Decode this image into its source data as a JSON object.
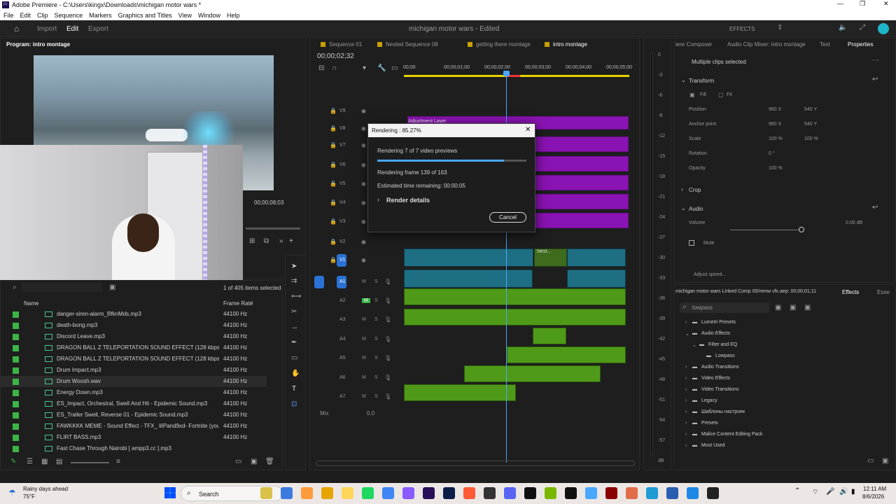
{
  "window": {
    "title": "Adobe Premiere - C:\\Users\\kingx\\Downloads\\michigan motor wars *"
  },
  "menu": [
    "File",
    "Edit",
    "Clip",
    "Sequence",
    "Markers",
    "Graphics and Titles",
    "View",
    "Window",
    "Help"
  ],
  "topbar": {
    "tabs": [
      "Import",
      "Edit",
      "Export"
    ],
    "project": "michigan motor wars - Edited",
    "effects_label": "EFFECTS"
  },
  "program": {
    "label": "Program: intro montage",
    "timecode": "00;00;08;03"
  },
  "project_panel": {
    "count": "1 of 405 items selected",
    "col_name": "Name",
    "col_rate": "Frame Rate",
    "rows": [
      {
        "name": "danger-siren-alarm_BfknMds.mp3",
        "rate": "44100 Hz"
      },
      {
        "name": "death-bong.mp3",
        "rate": "44100 Hz"
      },
      {
        "name": "Discord Leave.mp3",
        "rate": "44100 Hz"
      },
      {
        "name": "DRAGON BALL Z TELEPORTATION SOUND EFFECT (128  kbps).mp3",
        "rate": "44100 Hz"
      },
      {
        "name": "DRAGON BALL Z TELEPORTATION SOUND EFFECT (128  kbps)_001.m",
        "rate": "44100 Hz"
      },
      {
        "name": "Drum Impact.mp3",
        "rate": "44100 Hz"
      },
      {
        "name": "Drum Woosh.wav",
        "rate": "44100 Hz"
      },
      {
        "name": "Energy Down.mp3",
        "rate": "44100 Hz"
      },
      {
        "name": "ES_Impact, Orchestral, Swell And Hit - Epidemic Sound.mp3",
        "rate": "44100 Hz"
      },
      {
        "name": "ES_Trailer Swell, Reverse 01 - Epidemic Sound.mp3",
        "rate": "44100 Hz"
      },
      {
        "name": "FAWKKKK MEME - Sound Effect - TFX_ liIPand9xd- Fortnite (youtube).",
        "rate": "44100 Hz"
      },
      {
        "name": "FLIRT BASS.mp3",
        "rate": "44100 Hz"
      },
      {
        "name": "Fast Chase Through Nairobi [ ampp3.cc ].mp3",
        "rate": ""
      }
    ]
  },
  "timeline": {
    "tabs": [
      "Sequence 01",
      "Nested Sequence 08",
      "getting there montage",
      "intro montage"
    ],
    "timecode": "00;00;02;32",
    "ruler": [
      "00;00",
      "00;00;01;00",
      "00;00;02;00",
      "00;00;03;00",
      "00;00;04;00",
      "00;00;05;00"
    ],
    "video_tracks": [
      "V9",
      "V8",
      "V7",
      "V6",
      "V5",
      "V4",
      "V3",
      "V2",
      "V1"
    ],
    "audio_tracks": [
      "A1",
      "A2",
      "A3",
      "A4",
      "A5",
      "A6",
      "A7"
    ],
    "mix": "Mix",
    "mix_val": "0.0",
    "adjustment_label": "Adjustment Layer",
    "nest_label": "Nest..."
  },
  "dialog": {
    "title": "Rendering : 85.27%",
    "line1": "Rendering 7 of 7 video previews",
    "progress": 0.85,
    "line2": "Rendering frame 139 of 163",
    "line3": "Estimated time remaining: 00:00:05",
    "details": "Render details",
    "cancel": "Cancel"
  },
  "meter": [
    "0",
    "-3",
    "-6",
    "-9",
    "-12",
    "-15",
    "-18",
    "-21",
    "-24",
    "-27",
    "-30",
    "-33",
    "-36",
    "-39",
    "-42",
    "-45",
    "-48",
    "-51",
    "-54",
    "-57",
    "dB"
  ],
  "props": {
    "tabs": [
      "iere Composer",
      "Audio Clip Mixer: intro montage",
      "Text",
      "Properties"
    ],
    "subtitle": "Multiple clips selected",
    "transform": "Transform",
    "fill": "Fill",
    "fit": "Fit",
    "rows": [
      {
        "k": "Position",
        "a": "960 X",
        "b": "540 Y"
      },
      {
        "k": "Anchor point",
        "a": "960 X",
        "b": "540 Y"
      },
      {
        "k": "Scale",
        "a": "100 %",
        "b": "100 %"
      },
      {
        "k": "Rotation",
        "a": "0 °",
        "b": ""
      },
      {
        "k": "Opacity",
        "a": "100 %",
        "b": ""
      }
    ],
    "crop": "Crop",
    "audio": "Audio",
    "volume": "Volume",
    "volume_val": "0.00 dB",
    "mute": "Mute",
    "adjust_speed": "Adjust speed..."
  },
  "effects_panel": {
    "header": "michigan motor wars Linked Comp 05/mmw vfx.aep: 00;00;01;11",
    "tab": "Effects",
    "tab2": "Esse",
    "search": "lowpass",
    "items": [
      "Lumetri Presets",
      "Audio Effects",
      "Filter and EQ",
      "Lowpass",
      "Audio Transitions",
      "Video Effects",
      "Video Transitions",
      "Legacy",
      "Шаблоны настроек",
      "Presets",
      "Malice Content Editing Pack",
      "Most Used"
    ]
  },
  "taskbar": {
    "weather1": "Rainy days ahead",
    "weather2": "75°F",
    "search": "Search",
    "time": "12:11 AM",
    "date": "8/6/2026"
  }
}
